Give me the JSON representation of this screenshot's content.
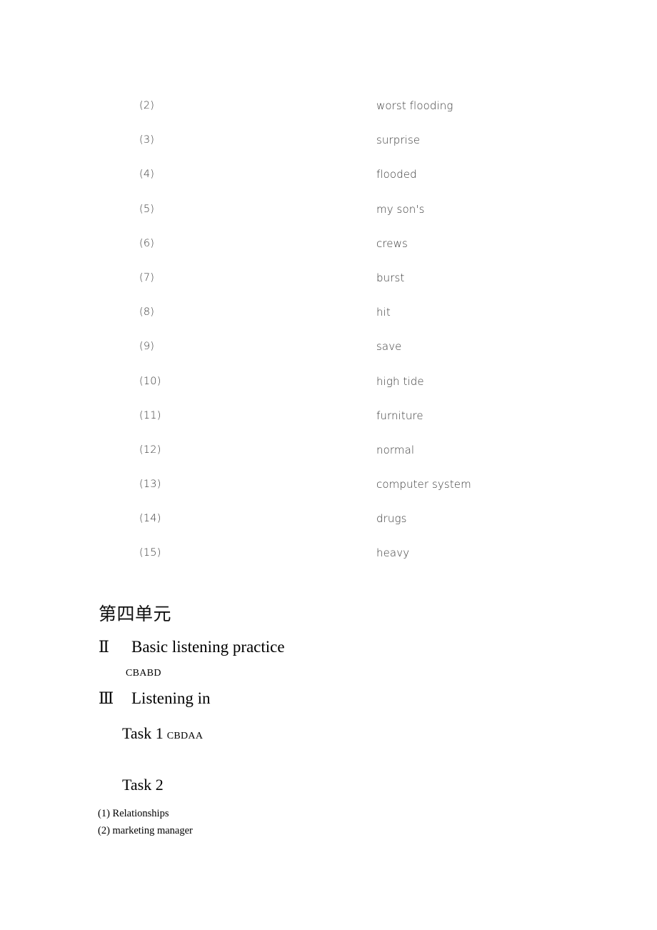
{
  "document": {
    "blank_fill_answers": [
      {
        "number": "(2)",
        "answer": "worst flooding"
      },
      {
        "number": "(3)",
        "answer": "surprise"
      },
      {
        "number": "(4)",
        "answer": "flooded"
      },
      {
        "number": "(5)",
        "answer": "my son's"
      },
      {
        "number": "(6)",
        "answer": "crews"
      },
      {
        "number": "(7)",
        "answer": "burst"
      },
      {
        "number": "(8)",
        "answer": "hit"
      },
      {
        "number": "(9)",
        "answer": "save"
      },
      {
        "number": "(10)",
        "answer": "high tide"
      },
      {
        "number": "(11)",
        "answer": "furniture"
      },
      {
        "number": "(12)",
        "answer": "normal"
      },
      {
        "number": "(13)",
        "answer": "computer system"
      },
      {
        "number": "(14)",
        "answer": "drugs"
      },
      {
        "number": "(15)",
        "answer": "heavy"
      }
    ],
    "unit_title": "第四单元",
    "sections": [
      {
        "numeral": "Ⅱ",
        "title": "Basic listening practice",
        "answer": "CBABD"
      },
      {
        "numeral": "Ⅲ",
        "title": "Listening in"
      }
    ],
    "tasks": [
      {
        "label": "Task 1",
        "answer": "CBDAA"
      },
      {
        "label": "Task 2",
        "answer": ""
      }
    ],
    "task2_answers": [
      "(1) Relationships",
      "(2) marketing manager"
    ]
  }
}
